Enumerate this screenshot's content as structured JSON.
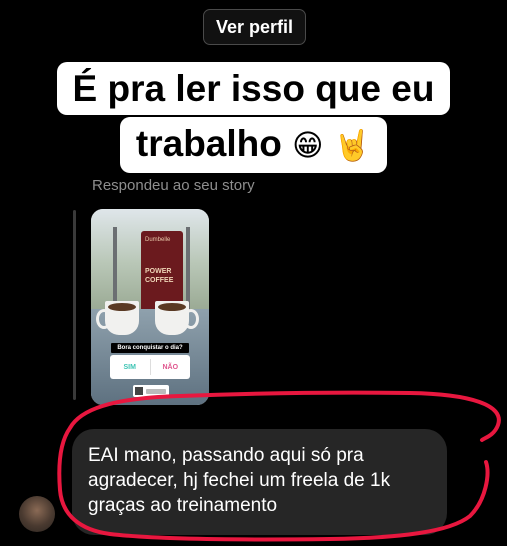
{
  "header": {
    "ver_perfil_label": "Ver perfil"
  },
  "overlay": {
    "line1": "É pra ler isso que eu",
    "line2": "trabalho",
    "emoji_grin": "😁",
    "emoji_horns": "🤘"
  },
  "story_reply": {
    "label": "Respondeu ao seu story",
    "story": {
      "bag_brand": "Dumbelle",
      "bag_title": "POWER COFFEE",
      "poll_question": "Bora conquistar o dia?",
      "poll_options": [
        "SIM",
        "NÃO"
      ]
    }
  },
  "message": {
    "text": "EAI mano, passando aqui só pra agradecer, hj fechei um freela de 1k graças ao treinamento"
  },
  "colors": {
    "background": "#000000",
    "bubble": "#262626",
    "annotation": "#e8173f",
    "poll_yes": "#3cc4b4",
    "poll_no": "#e0568e"
  }
}
